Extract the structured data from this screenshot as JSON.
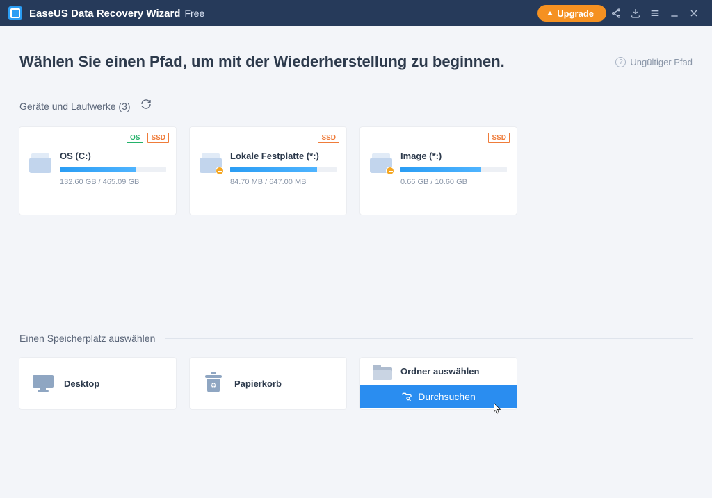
{
  "titlebar": {
    "app_name": "EaseUS Data Recovery Wizard",
    "edition": "Free",
    "upgrade_label": "Upgrade"
  },
  "header": {
    "page_title": "Wählen Sie einen Pfad, um mit der Wiederherstellung zu beginnen.",
    "invalid_path_label": "Ungültiger Pfad"
  },
  "drives_section": {
    "title": "Geräte und Laufwerke (3)"
  },
  "drives": [
    {
      "name": "OS (C:)",
      "size_text": "132.60 GB / 465.09 GB",
      "fill_pct": 72,
      "badges": [
        "OS",
        "SSD"
      ],
      "warn": false
    },
    {
      "name": "Lokale Festplatte (*:)",
      "size_text": "84.70 MB / 647.00 MB",
      "fill_pct": 82,
      "badges": [
        "SSD"
      ],
      "warn": true
    },
    {
      "name": "Image (*:)",
      "size_text": "0.66 GB / 10.60 GB",
      "fill_pct": 76,
      "badges": [
        "SSD"
      ],
      "warn": true
    }
  ],
  "locations_section": {
    "title": "Einen Speicherplatz auswählen"
  },
  "locations": {
    "desktop": "Desktop",
    "recycle_bin": "Papierkorb",
    "select_folder": "Ordner auswählen",
    "browse": "Durchsuchen"
  }
}
